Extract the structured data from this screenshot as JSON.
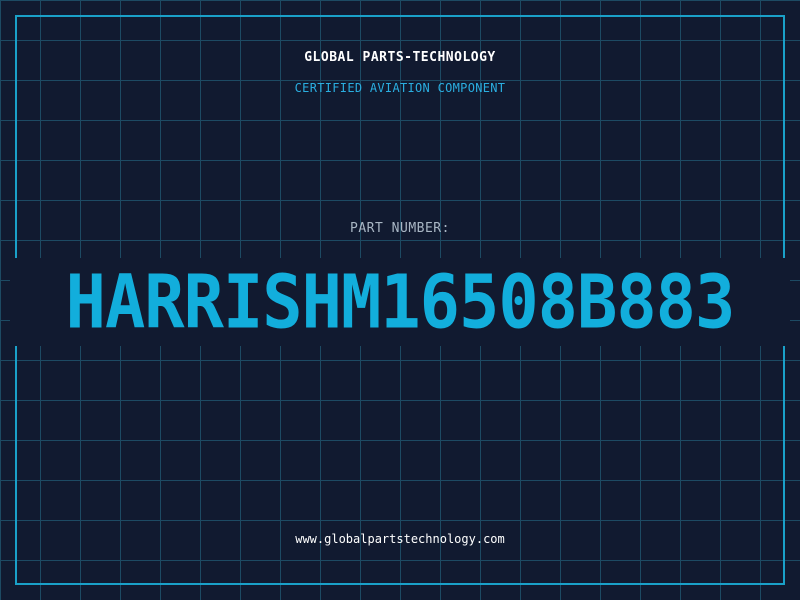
{
  "brand": {
    "title": "GLOBAL PARTS-TECHNOLOGY",
    "subtitle": "CERTIFIED AVIATION COMPONENT"
  },
  "part": {
    "label": "PART NUMBER:",
    "number": "HARRISHM16508B883"
  },
  "footer": {
    "website": "www.globalpartstechnology.com"
  },
  "colors": {
    "background": "#111a30",
    "grid": "#1d4a63",
    "frame": "#1aa0c8",
    "accent": "#12aedc",
    "label": "#a9b6c4",
    "text": "#ffffff"
  }
}
